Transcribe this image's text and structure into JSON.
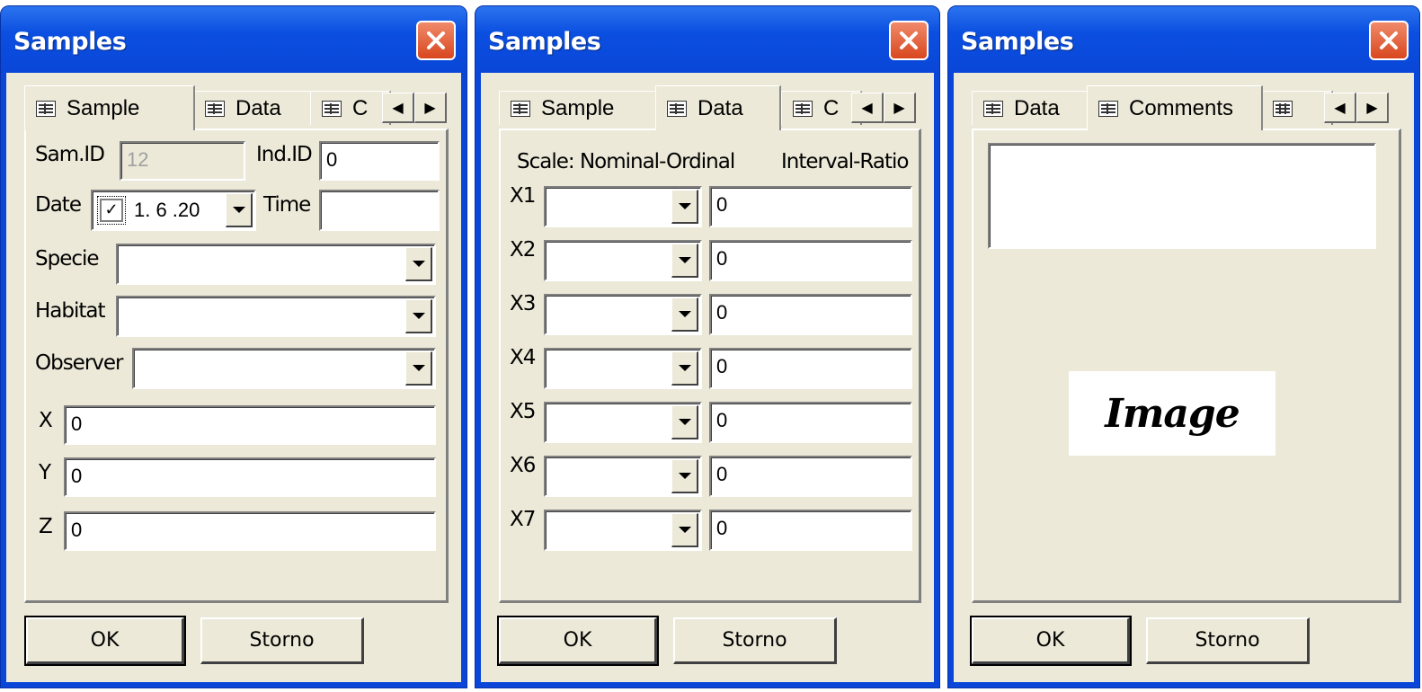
{
  "windows": [
    {
      "title": "Samples",
      "tabs": [
        "Sample",
        "Data",
        "C"
      ],
      "fields": {
        "sam_id_label": "Sam.ID",
        "sam_id_value": "12",
        "ind_id_label": "Ind.ID",
        "ind_id_value": "0",
        "date_label": "Date",
        "date_checked": "✓",
        "date_value": "1. 6 .20",
        "time_label": "Time",
        "time_value": "",
        "specie_label": "Specie",
        "habitat_label": "Habitat",
        "observer_label": "Observer",
        "x_label": "X",
        "x_value": "0",
        "y_label": "Y",
        "y_value": "0",
        "z_label": "Z",
        "z_value": "0"
      },
      "ok_label": "OK",
      "cancel_label": "Storno"
    },
    {
      "title": "Samples",
      "tabs": [
        "Sample",
        "Data",
        "C"
      ],
      "scale_label": "Scale: Nominal-Ordinal",
      "interval_label": "Interval-Ratio",
      "rows": [
        {
          "label": "X1",
          "value": "0"
        },
        {
          "label": "X2",
          "value": "0"
        },
        {
          "label": "X3",
          "value": "0"
        },
        {
          "label": "X4",
          "value": "0"
        },
        {
          "label": "X5",
          "value": "0"
        },
        {
          "label": "X6",
          "value": "0"
        },
        {
          "label": "X7",
          "value": "0"
        }
      ],
      "ok_label": "OK",
      "cancel_label": "Storno"
    },
    {
      "title": "Samples",
      "tabs": [
        "Data",
        "Comments"
      ],
      "image_label": "Image",
      "ok_label": "OK",
      "cancel_label": "Storno"
    }
  ],
  "icons": {
    "close": "close-icon",
    "tab": "form-icon",
    "tab_grid": "table-icon",
    "left": "arrow-left-icon",
    "right": "arrow-right-icon"
  },
  "colors": {
    "titlebar": "#0a46d8",
    "client": "#ece9d8",
    "close": "#d8471f"
  }
}
